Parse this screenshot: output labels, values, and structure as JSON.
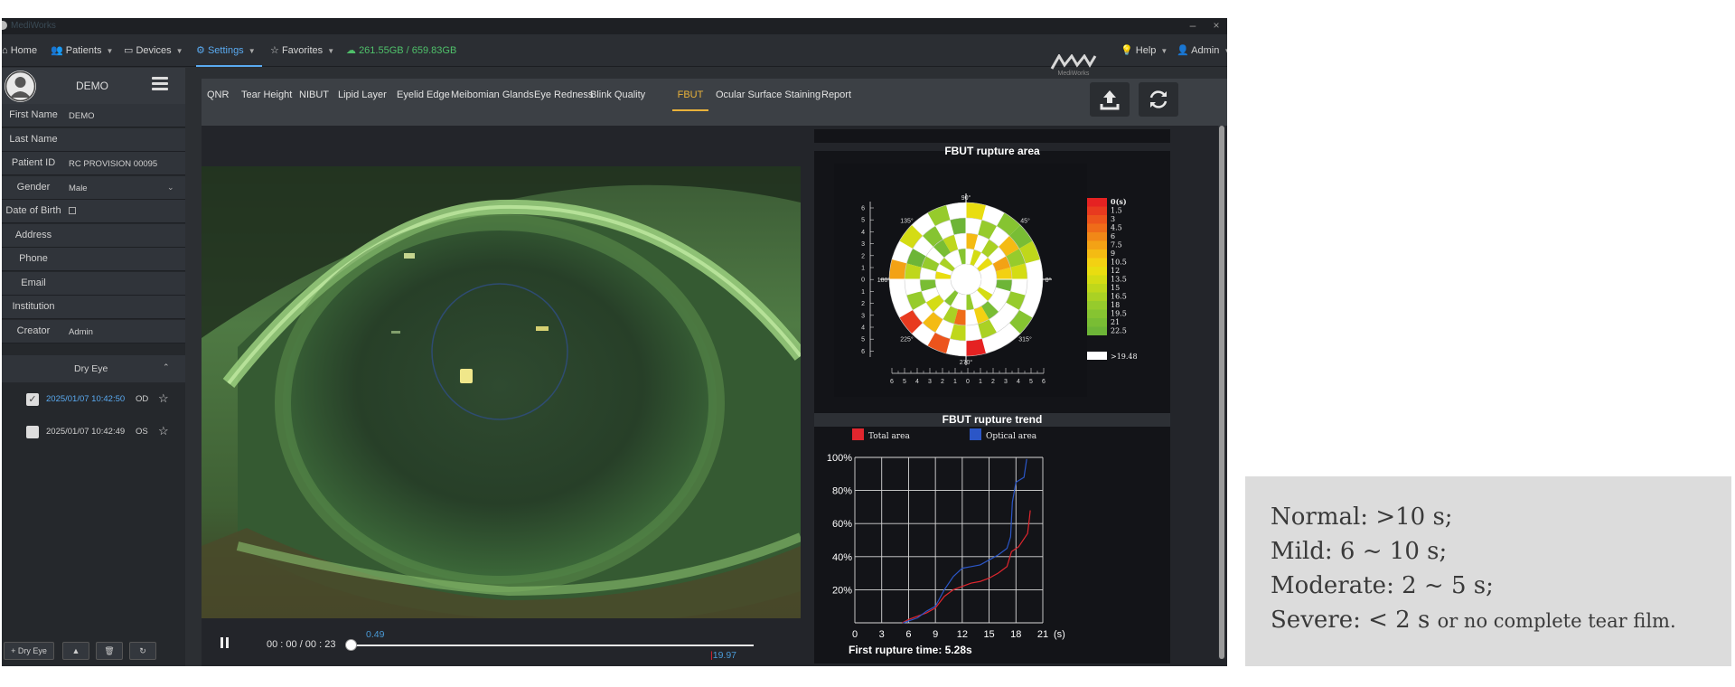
{
  "window": {
    "title": "MediWorks",
    "min_label": "–",
    "close_label": "×"
  },
  "nav": {
    "home": "Home",
    "patients": "Patients",
    "devices": "Devices",
    "settings": "Settings",
    "favorites": "Favorites",
    "storage": "261.55GB / 659.83GB",
    "help": "Help",
    "admin": "Admin",
    "brand": "MediWorks"
  },
  "patient": {
    "name": "DEMO",
    "fields": [
      {
        "label": "First Name",
        "value": "DEMO"
      },
      {
        "label": "Last Name",
        "value": ""
      },
      {
        "label": "Patient ID",
        "value": "RC PROVISION 00095"
      },
      {
        "label": "Gender",
        "value": "Male"
      },
      {
        "label": "Date of Birth",
        "value": ""
      },
      {
        "label": "Address",
        "value": ""
      },
      {
        "label": "Phone",
        "value": ""
      },
      {
        "label": "Email",
        "value": ""
      },
      {
        "label": "Institution",
        "value": ""
      },
      {
        "label": "Creator",
        "value": "Admin"
      }
    ]
  },
  "exam_group": {
    "label": "Dry Eye"
  },
  "exams": [
    {
      "date": "2025/01/07 10:42:50",
      "eye": "OD",
      "checked": true
    },
    {
      "date": "2025/01/07 10:42:49",
      "eye": "OS",
      "checked": false
    }
  ],
  "sidebar_buttons": {
    "add": "+ Dry Eye",
    "up": "▲",
    "delete": "🗑",
    "refresh": "↻"
  },
  "tabs": [
    "QNR",
    "Tear Height",
    "NIBUT",
    "Lipid Layer",
    "Eyelid Edge",
    "Meibomian Glands",
    "Eye Redness",
    "Blink Quality",
    "FBUT",
    "Ocular Surface Staining",
    "Report"
  ],
  "active_tab": "FBUT",
  "player": {
    "timecode": "00 : 00 / 00 : 23",
    "start_marker": "0.49",
    "end_marker": "19.97",
    "progress": 0.0
  },
  "rupture_area": {
    "title": "FBUT rupture area",
    "angles": [
      "90°",
      "45°",
      "0°",
      "315°",
      "270°",
      "225°",
      "180°",
      "135°"
    ],
    "axis_ticks": [
      "6",
      "5",
      "4",
      "3",
      "2",
      "1",
      "0",
      "1",
      "2",
      "3",
      "4",
      "5",
      "6"
    ],
    "scale_labels": [
      "0(s)",
      "1.5",
      "3",
      "4.5",
      "6",
      "7.5",
      "9",
      "10.5",
      "12",
      "13.5",
      "15",
      "16.5",
      "18",
      "19.5",
      "21",
      "22.5"
    ],
    "scale_colors": [
      "#e52222",
      "#e83a1f",
      "#ec541c",
      "#ef6c19",
      "#f18817",
      "#f3a215",
      "#f4bb13",
      "#f3d112",
      "#e9dd10",
      "#d4dc14",
      "#bfd71b",
      "#aad124",
      "#96cb2c",
      "#86c431",
      "#79bd34",
      "#6db537"
    ],
    "over_label": ">19.48",
    "over_color": "#ffffff"
  },
  "chart_data": {
    "type": "line",
    "title": "FBUT rupture trend",
    "xlabel": "(s)",
    "x_ticks": [
      0,
      3,
      6,
      9,
      12,
      15,
      18,
      21
    ],
    "y_ticks": [
      "20%",
      "40%",
      "60%",
      "80%",
      "100%"
    ],
    "xlim": [
      0,
      21
    ],
    "ylim": [
      0,
      100
    ],
    "grid": true,
    "legend_position": "top",
    "series": [
      {
        "name": "Total area",
        "color": "#e0262e",
        "points": [
          [
            5.3,
            0
          ],
          [
            6,
            2
          ],
          [
            8,
            6
          ],
          [
            9,
            9
          ],
          [
            10,
            16
          ],
          [
            11,
            20
          ],
          [
            12,
            22
          ],
          [
            13,
            24
          ],
          [
            14,
            25
          ],
          [
            15,
            27
          ],
          [
            16,
            30
          ],
          [
            17,
            34
          ],
          [
            17.5,
            43
          ],
          [
            18.3,
            46
          ],
          [
            19.3,
            54
          ],
          [
            19.5,
            63
          ],
          [
            19.6,
            68
          ]
        ]
      },
      {
        "name": "Optical area",
        "color": "#2b56c7",
        "points": [
          [
            5.4,
            0
          ],
          [
            7,
            3
          ],
          [
            8,
            7
          ],
          [
            9,
            10
          ],
          [
            10,
            20
          ],
          [
            11,
            28
          ],
          [
            12,
            33
          ],
          [
            13,
            34
          ],
          [
            14,
            35
          ],
          [
            15,
            38
          ],
          [
            16,
            41
          ],
          [
            17,
            45
          ],
          [
            17.4,
            52
          ],
          [
            17.6,
            73
          ],
          [
            18,
            85
          ],
          [
            18.3,
            86
          ],
          [
            18.9,
            88
          ],
          [
            19.2,
            99
          ]
        ]
      }
    ],
    "annotation": "First rupture time: 5.28s"
  },
  "note": {
    "normal": "Normal: >10 s;",
    "mild": "Mild: 6 ~ 10 s;",
    "moderate": "Moderate: 2 ~ 5 s;",
    "severe": "Severe: < 2 s",
    "severe_tail": "or no complete tear film."
  }
}
